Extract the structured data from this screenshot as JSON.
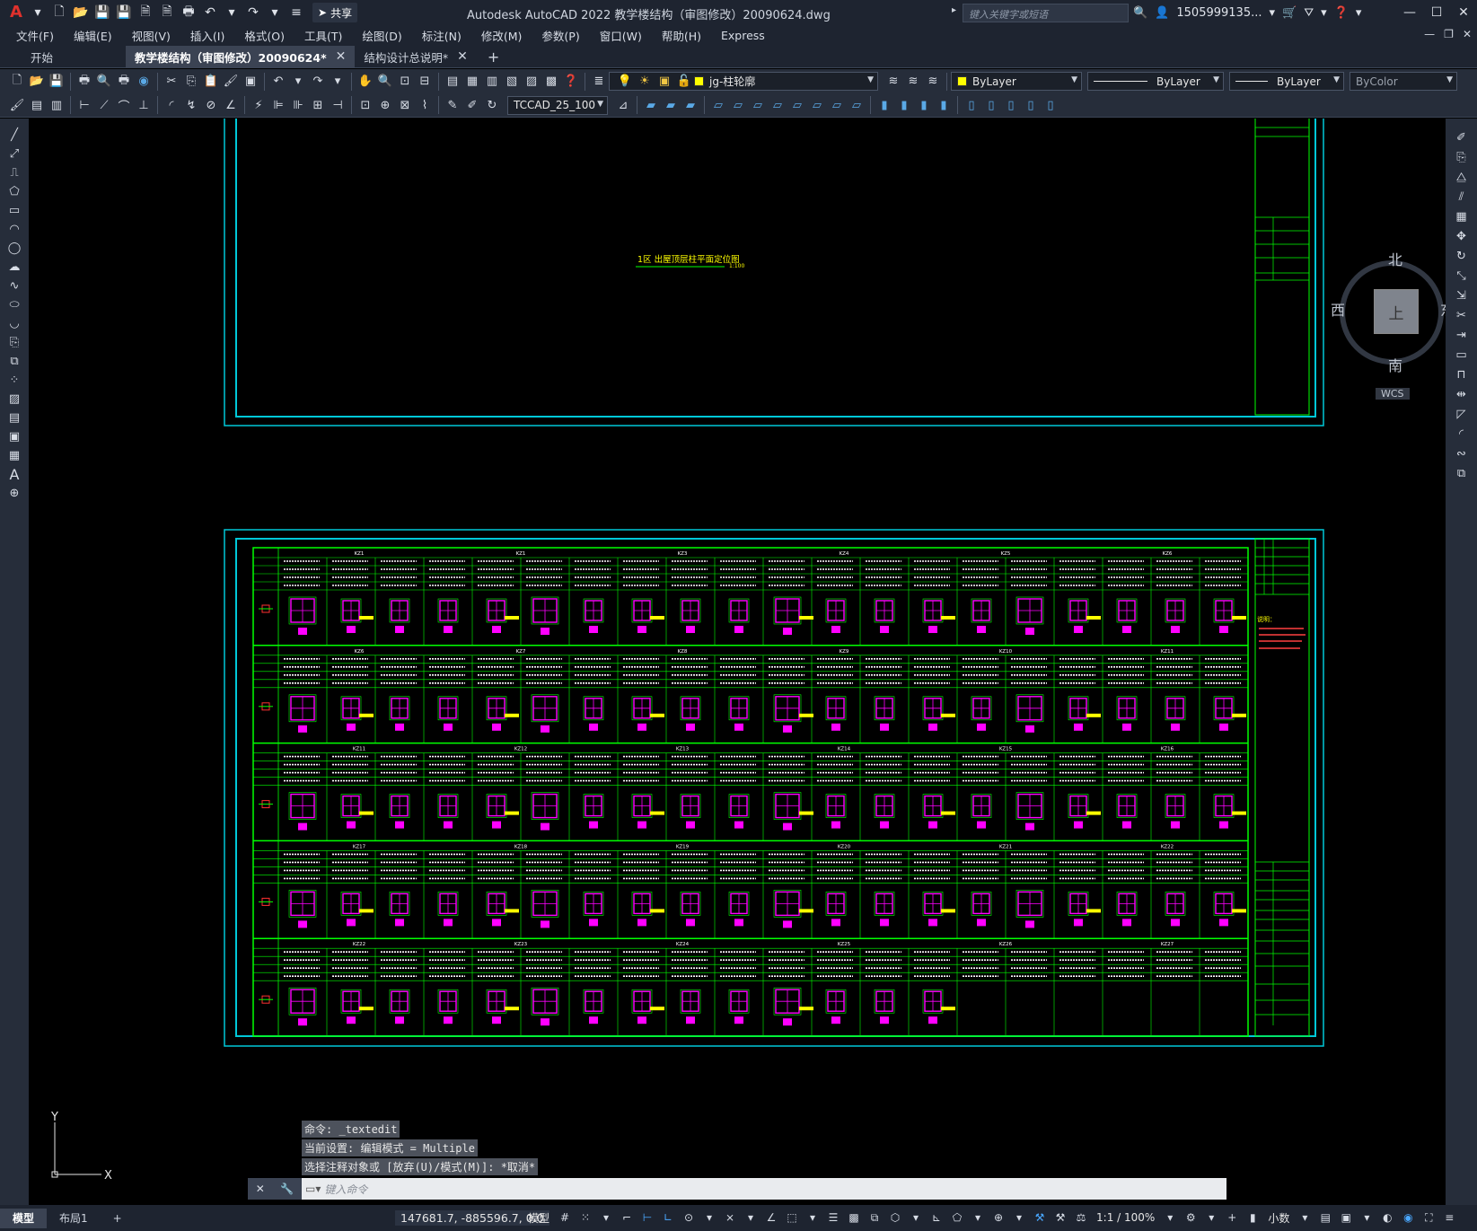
{
  "title_bar": {
    "app_title": "Autodesk AutoCAD 2022    教学楼结构（审图修改）20090624.dwg",
    "share_label": "共享",
    "search_placeholder": "键入关键字或短语",
    "user": "1505999135...",
    "help_icon": "question-icon"
  },
  "menu": {
    "items": [
      "文件(F)",
      "编辑(E)",
      "视图(V)",
      "插入(I)",
      "格式(O)",
      "工具(T)",
      "绘图(D)",
      "标注(N)",
      "修改(M)",
      "参数(P)",
      "窗口(W)",
      "帮助(H)",
      "Express"
    ]
  },
  "tabs": {
    "start": "开始",
    "active": "教学楼结构（审图修改）20090624*",
    "third": "结构设计总说明*"
  },
  "toolbar": {
    "layer_value": "jg-柱轮廓",
    "color_value": "ByLayer",
    "linetype_value": "ByLayer",
    "lineweight_value": "ByLayer",
    "plotstyle_value": "ByColor",
    "text_style_value": "TCCAD_25_100"
  },
  "viewcube": {
    "north": "北",
    "south": "南",
    "east": "东",
    "west": "西",
    "center": "上",
    "wcs": "WCS"
  },
  "drawing": {
    "top_title": "1区 出屋顶层柱平面定位图",
    "top_scale": "1:100",
    "column_marks_row1": [
      "KZ1",
      "KZ1",
      "KZ3",
      "KZ4",
      "KZ5",
      "KZ6"
    ],
    "column_marks_row2": [
      "KZ6",
      "KZ7",
      "KZ8",
      "KZ9",
      "KZ10",
      "KZ11"
    ],
    "column_marks_row3": [
      "KZ11",
      "KZ12",
      "KZ13",
      "KZ14",
      "KZ15",
      "KZ16"
    ],
    "column_marks_row4": [
      "KZ17",
      "KZ18",
      "KZ19",
      "KZ20",
      "KZ21",
      "KZ22"
    ],
    "column_marks_row5": [
      "KZ22",
      "KZ23",
      "KZ24",
      "KZ25",
      "KZ26",
      "KZ27"
    ],
    "notes_title": "说明："
  },
  "ucs": {
    "x": "X",
    "y": "Y"
  },
  "command": {
    "history": [
      "命令: _textedit",
      "当前设置: 编辑模式 = Multiple",
      "选择注释对象或 [放弃(U)/模式(M)]: *取消*"
    ],
    "placeholder": "键入命令"
  },
  "status": {
    "tab_model": "模型",
    "tab_layout": "布局1",
    "coords": "147681.7, -885596.7, 0.0",
    "model_label": "模型",
    "scale": "1:1 / 100%",
    "units": "小数"
  }
}
